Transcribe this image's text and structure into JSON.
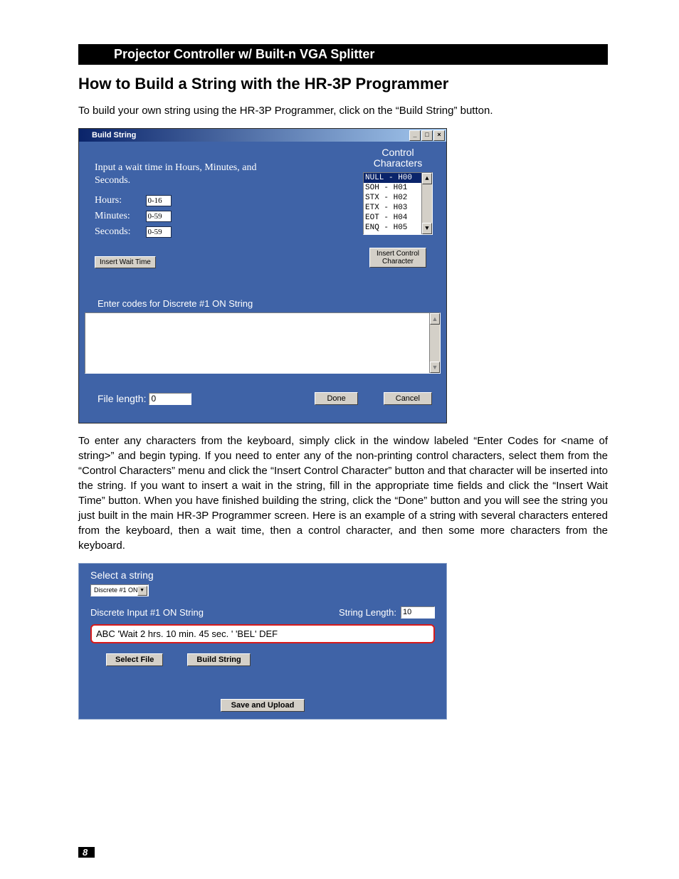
{
  "header_bar": "Projector Controller w/ Built-n VGA Splitter",
  "heading": "How to Build a String with the HR-3P Programmer",
  "intro_para": "To build your own string using the HR-3P Programmer, click on the “Build String” button.",
  "dialog1": {
    "title": "Build String",
    "instruction": "Input a wait time in Hours, Minutes, and Seconds.",
    "rows": {
      "hours_label": "Hours:",
      "hours_value": "0-16",
      "minutes_label": "Minutes:",
      "minutes_value": "0-59",
      "seconds_label": "Seconds:",
      "seconds_value": "0-59"
    },
    "insert_wait_btn": "Insert Wait Time",
    "ctrl_header_line1": "Control",
    "ctrl_header_line2": "Characters",
    "ctrl_list": [
      "NULL - H00",
      "SOH - H01",
      "STX  - H02",
      "ETX  - H03",
      "EOT - H04",
      "ENQ - H05"
    ],
    "insert_ctrl_btn_l1": "Insert Control",
    "insert_ctrl_btn_l2": "Character",
    "enter_codes_label": "Enter codes for Discrete #1 ON String",
    "file_length_label": "File length:",
    "file_length_value": "0",
    "done_btn": "Done",
    "cancel_btn": "Cancel"
  },
  "para2": "To enter any characters from the keyboard, simply click in the window labeled “Enter Codes for <name of string>” and begin typing. If you need to enter any of the non-printing control characters, select them from the “Control Characters” menu and click the “Insert Control Character” button and that character will be inserted into the string. If you want to insert a wait in the string, fill in the appropriate time fields and click the “Insert Wait Time” button. When you have finished building the string, click the “Done” button and you will see the string you just built in the main HR-3P Programmer screen. Here is an example of a string with several characters entered from the keyboard, then a wait time, then a control character, and then some more characters from the keyboard.",
  "panel2": {
    "select_label": "Select a string",
    "combo_value": "Discrete #1 ON",
    "string_name_label": "Discrete Input #1 ON String",
    "string_length_label": "String Length:",
    "string_length_value": "10",
    "string_value": "ABC 'Wait  2 hrs.  10 min.  45 sec. ' 'BEL' DEF",
    "select_file_btn": "Select File",
    "build_string_btn": "Build String",
    "save_btn": "Save and Upload"
  },
  "page_number": "8"
}
